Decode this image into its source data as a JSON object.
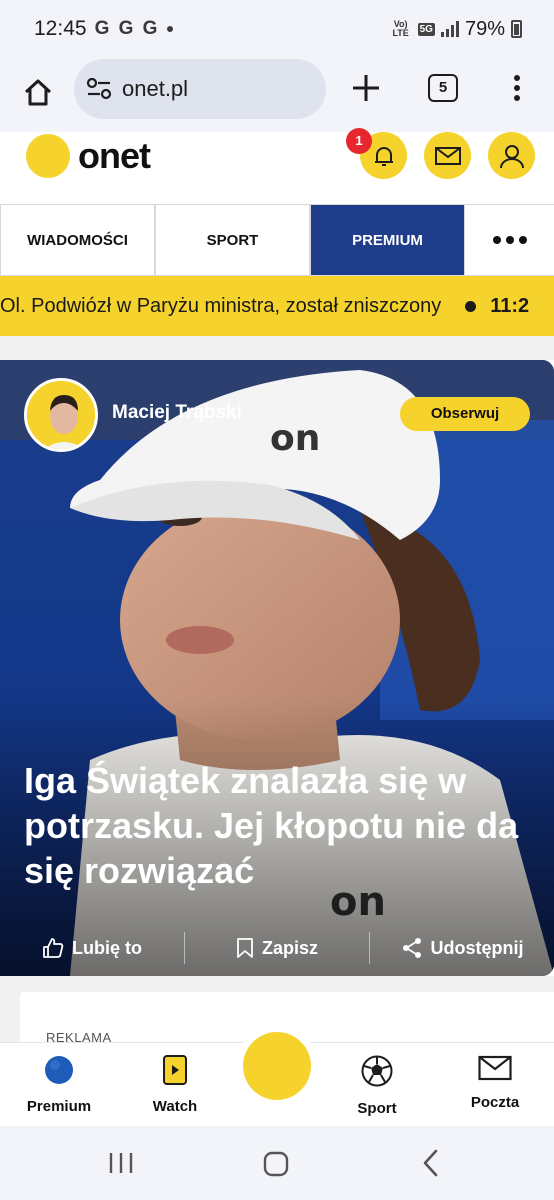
{
  "status_bar": {
    "time": "12:45",
    "carrier_icons": "G G G",
    "volte_label": "Vo) LTE",
    "network": "5G",
    "battery": "79%"
  },
  "browser": {
    "url": "onet.pl",
    "tab_count": "5"
  },
  "header": {
    "logo_text": "onet",
    "notification_count": "1"
  },
  "nav_tabs": [
    {
      "label": "WIADOMOŚCI"
    },
    {
      "label": "SPORT"
    },
    {
      "label": "PREMIUM"
    }
  ],
  "ticker": {
    "text": "Ol. Podwiózł w Paryżu ministra, został zniszczony",
    "next_time": "11:2"
  },
  "article": {
    "author": "Maciej Trąbski",
    "follow_label": "Obserwuj",
    "headline": "Iga Świątek znalazła się w potrzasku. Jej kłopotu nie da się rozwiązać",
    "actions": {
      "like": "Lubię to",
      "save": "Zapisz",
      "share": "Udostępnij"
    }
  },
  "ad": {
    "label": "REKLAMA"
  },
  "bottom_nav": [
    {
      "label": "Premium"
    },
    {
      "label": "Watch"
    },
    {
      "label": "Sport"
    },
    {
      "label": "Poczta"
    }
  ],
  "colors": {
    "brand_yellow": "#f6d32c",
    "premium_blue": "#1f3d8a",
    "badge_red": "#e8262d"
  }
}
